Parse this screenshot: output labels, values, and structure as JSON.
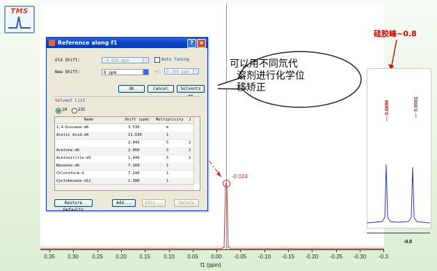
{
  "logo": {
    "text": "TMS"
  },
  "spectrum": {
    "x_ticks": [
      "0.35",
      "0.30",
      "0.25",
      "0.20",
      "0.15",
      "0.10",
      "0.05",
      "0.00",
      "-0.05",
      "-0.10",
      "-0.15",
      "-0.20",
      "-0.25",
      "-0.30",
      "-0.3"
    ],
    "x_axis_title": "f1 (ppm)",
    "peak_label": "-0.024"
  },
  "dialog": {
    "title": "Reference along f1",
    "old_shift_label": "Old Shift:",
    "old_shift_value": "-0.024 ppm",
    "auto_tuning_label": "Auto Tuning",
    "new_shift_label": "New Shift:",
    "new_shift_value": "0 ppm",
    "pm_label": "+/-",
    "pm_value": "0.100 ppm",
    "ok_label": "OK",
    "cancel_label": "Cancel",
    "solvents_label": "Solvents <<",
    "solvent_list_label": "Solvent List",
    "radio_1h": "1H",
    "radio_13c": "13C",
    "columns": [
      "Name",
      "Shift (ppm)",
      "Multiplicity",
      "J"
    ],
    "rows": [
      {
        "name": "1,4-Dioxane-d8",
        "shift": "3.530",
        "mult": "m",
        "j": ""
      },
      {
        "name": "Acetic Acid-d4",
        "shift": "11.650",
        "mult": "1",
        "j": ""
      },
      {
        "name": "",
        "shift": "2.040",
        "mult": "5",
        "j": "2"
      },
      {
        "name": "Acetone-d6",
        "shift": "2.050",
        "mult": "5",
        "j": "2"
      },
      {
        "name": "Acetonitrile-d3",
        "shift": "1.940",
        "mult": "5",
        "j": "2"
      },
      {
        "name": "Benzene-d6",
        "shift": "7.160",
        "mult": "1",
        "j": ""
      },
      {
        "name": "Chloroform-d",
        "shift": "7.240",
        "mult": "1",
        "j": ""
      },
      {
        "name": "Cyclohexane-d12",
        "shift": "1.380",
        "mult": "1",
        "j": ""
      }
    ],
    "restore_label": "Restore Defaults",
    "add_label": "Add...",
    "edit_label": "Edit...",
    "delete_label": "Delete"
  },
  "callout": {
    "lines": [
      "可以用不同氘代",
      "溶剂进行化学位",
      "移矫正"
    ]
  },
  "inset": {
    "title": "硅胶峰~0.8",
    "peak1_label": "— 0.0696",
    "peak2_label": "— 0.0001",
    "axis_label": "-0.0",
    "peak1_level": 0.42,
    "peak2_level": 0.4
  },
  "colors": {
    "accent_red": "#e00000",
    "spectrum_blue": "#2233cc",
    "title_blue": "#0b46c9"
  }
}
